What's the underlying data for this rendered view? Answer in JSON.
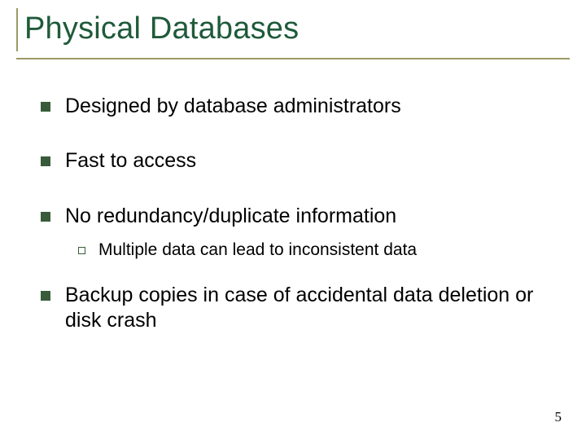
{
  "title": "Physical Databases",
  "bullets": {
    "b1": "Designed by database administrators",
    "b2": "Fast to access",
    "b3": "No redundancy/duplicate information",
    "b3_sub1": "Multiple data can lead to inconsistent data",
    "b4": "Backup copies in case of accidental data deletion or disk crash"
  },
  "page_number": "5"
}
